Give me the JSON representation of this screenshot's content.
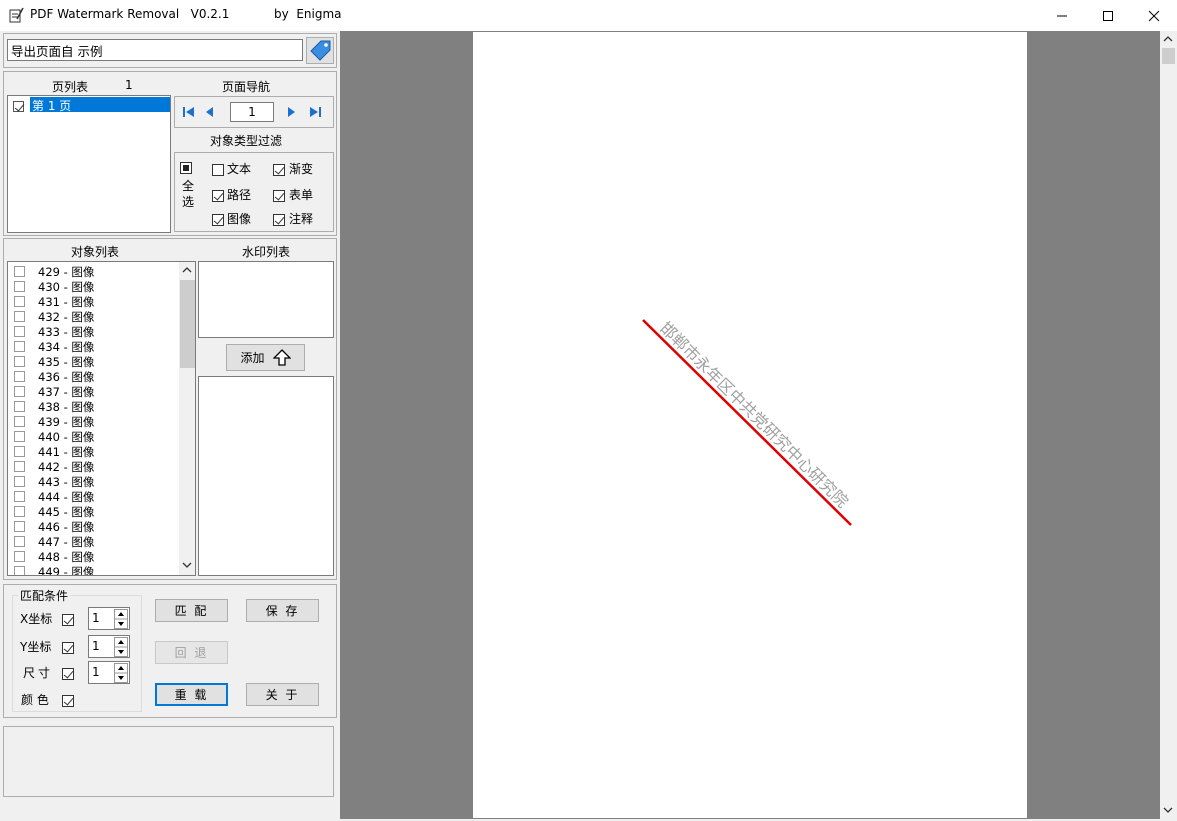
{
  "window": {
    "title": "PDF Watermark Removal   V0.2.1",
    "author": "by  Enigma",
    "minimize_icon": "minimize-icon",
    "maximize_icon": "maximize-icon",
    "close_icon": "close-icon"
  },
  "export_field": {
    "value": "导出页面自 示例"
  },
  "page_list": {
    "header": "页列表",
    "count": "1",
    "items": [
      {
        "label": "第 1 页",
        "checked": true,
        "selected": true
      }
    ]
  },
  "page_nav": {
    "header": "页面导航",
    "page_value": "1"
  },
  "filter": {
    "header": "对象类型过滤",
    "select_all": "全选",
    "options": [
      {
        "label": "文本",
        "checked": false
      },
      {
        "label": "渐变",
        "checked": true
      },
      {
        "label": "路径",
        "checked": true
      },
      {
        "label": "表单",
        "checked": true
      },
      {
        "label": "图像",
        "checked": true
      },
      {
        "label": "注释",
        "checked": true
      }
    ]
  },
  "object_list": {
    "header": "对象列表",
    "items": [
      "429 - 图像",
      "430 - 图像",
      "431 - 图像",
      "432 - 图像",
      "433 - 图像",
      "434 - 图像",
      "435 - 图像",
      "436 - 图像",
      "437 - 图像",
      "438 - 图像",
      "439 - 图像",
      "440 - 图像",
      "441 - 图像",
      "442 - 图像",
      "443 - 图像",
      "444 - 图像",
      "445 - 图像",
      "446 - 图像",
      "447 - 图像",
      "448 - 图像",
      "449 - 图像"
    ]
  },
  "watermark_list": {
    "header": "水印列表",
    "add_label": "添加"
  },
  "match": {
    "group_label": "匹配条件",
    "rows": [
      {
        "label": "X坐标",
        "checked": true,
        "value": "1"
      },
      {
        "label": "Y坐标",
        "checked": true,
        "value": "1"
      },
      {
        "label": "尺寸",
        "checked": true,
        "value": "1"
      },
      {
        "label": "颜 色",
        "checked": true
      }
    ]
  },
  "buttons": {
    "match": "匹 配",
    "save": "保 存",
    "undo": "回 退",
    "reload": "重 载",
    "about": "关 于"
  },
  "preview": {
    "watermark_text": "邯郸市永年区中共党研究中心研究院",
    "line_color": "#e00000",
    "text_color": "#a0a0a0"
  }
}
